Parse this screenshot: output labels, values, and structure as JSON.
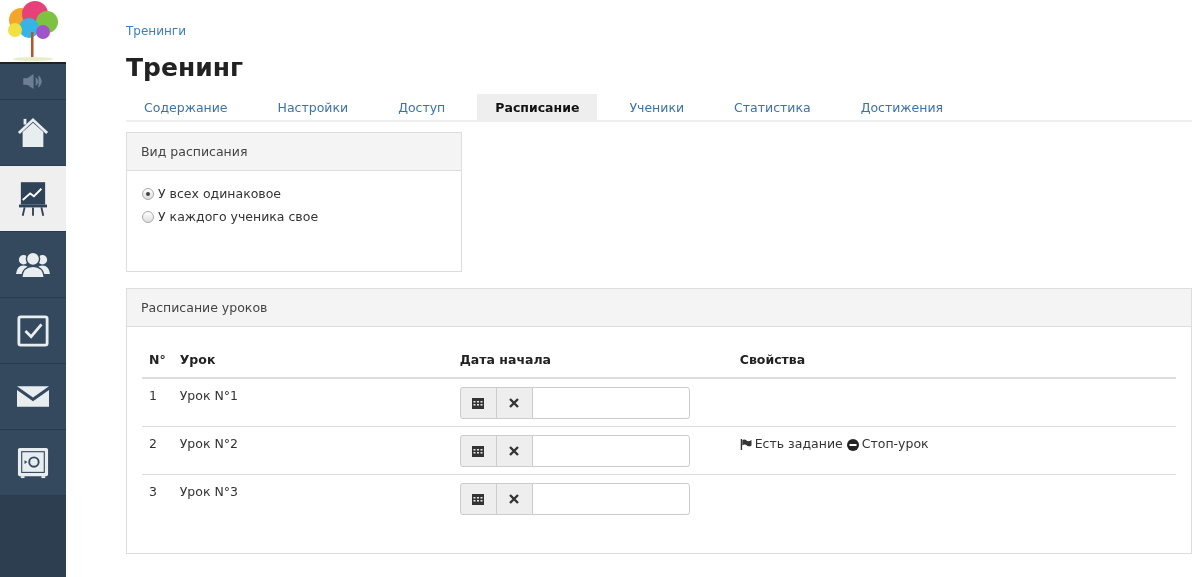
{
  "sidebar": {
    "items": [
      {
        "kind": "sound",
        "selected": false
      },
      {
        "kind": "home",
        "selected": false
      },
      {
        "kind": "chart",
        "selected": true
      },
      {
        "kind": "people",
        "selected": false
      },
      {
        "kind": "check",
        "selected": false
      },
      {
        "kind": "mail",
        "selected": false
      },
      {
        "kind": "safe",
        "selected": false
      }
    ]
  },
  "breadcrumb": "Тренинги",
  "title": "Тренинг",
  "tabs": [
    {
      "label": "Содержание",
      "selected": false
    },
    {
      "label": "Настройки",
      "selected": false
    },
    {
      "label": "Доступ",
      "selected": false
    },
    {
      "label": "Расписание",
      "selected": true
    },
    {
      "label": "Ученики",
      "selected": false
    },
    {
      "label": "Статистика",
      "selected": false
    },
    {
      "label": "Достижения",
      "selected": false
    }
  ],
  "schedule_type": {
    "title": "Вид расписания",
    "options": [
      {
        "label": "У всех одинаковое",
        "selected": true
      },
      {
        "label": "У каждого ученика свое",
        "selected": false
      }
    ]
  },
  "lessons": {
    "title": "Расписание уроков",
    "columns": [
      "N°",
      "Урок",
      "Дата начала",
      "Свойства"
    ],
    "rows": [
      {
        "number": "1",
        "lesson": "Урок N°1",
        "properties": []
      },
      {
        "number": "2",
        "lesson": "Урок N°2",
        "properties": [
          {
            "kind": "flag",
            "text": "Есть задание"
          },
          {
            "kind": "stop",
            "text": "Стоп-урок"
          }
        ]
      },
      {
        "number": "3",
        "lesson": "Урок N°3",
        "properties": []
      }
    ]
  }
}
